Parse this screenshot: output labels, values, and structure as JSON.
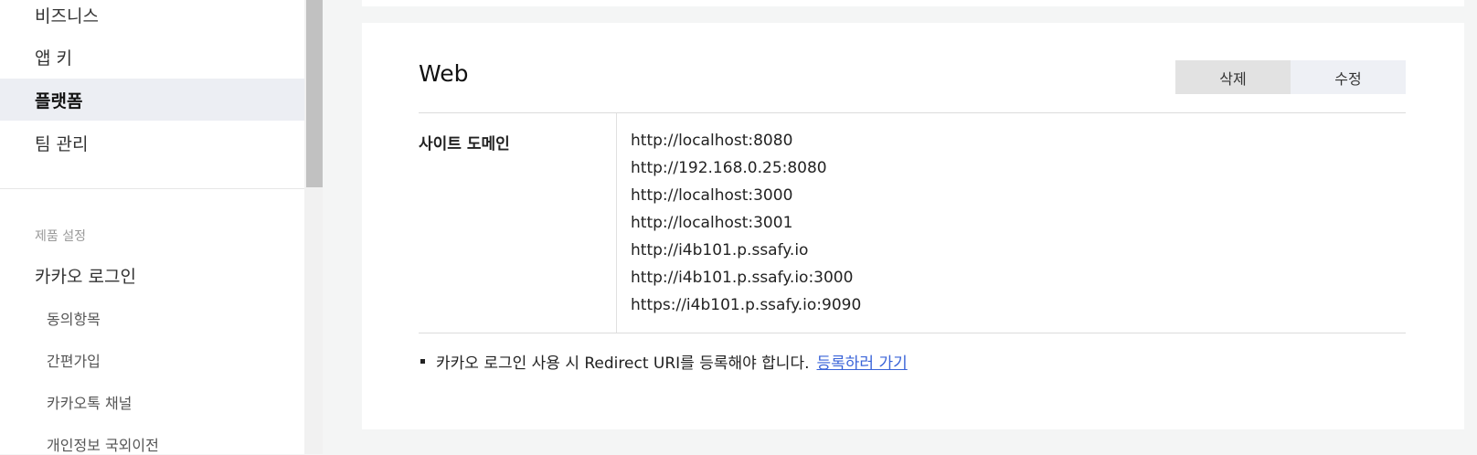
{
  "sidebar": {
    "nav": [
      {
        "label": "비즈니스"
      },
      {
        "label": "앱 키"
      },
      {
        "label": "플랫폼"
      },
      {
        "label": "팀 관리"
      }
    ],
    "section_title": "제품 설정",
    "product": "카카오 로그인",
    "sub_items": [
      "동의항목",
      "간편가입",
      "카카오톡 채널",
      "개인정보 국외이전"
    ]
  },
  "web_card": {
    "title": "Web",
    "delete_label": "삭제",
    "edit_label": "수정",
    "domain_label": "사이트 도메인",
    "domains": [
      "http://localhost:8080",
      "http://192.168.0.25:8080",
      "http://localhost:3000",
      "http://localhost:3001",
      "http://i4b101.p.ssafy.io",
      "http://i4b101.p.ssafy.io:3000",
      "https://i4b101.p.ssafy.io:9090"
    ],
    "note": "카카오 로그인 사용 시 Redirect URI를 등록해야 합니다.",
    "note_link": "등록하러 가기"
  },
  "colors": {
    "accent_link": "#3a64d8",
    "active_nav_bg": "#eceef3"
  }
}
